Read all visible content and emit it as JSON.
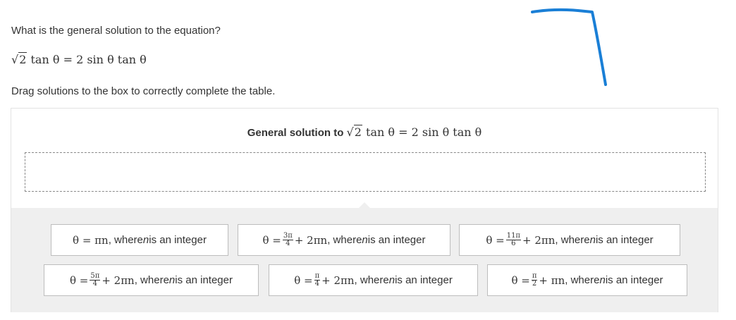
{
  "question": "What is the general solution to the equation?",
  "equation": {
    "lhs_coef_radicand": "2",
    "lhs_func": "tan θ",
    "equals": "=",
    "rhs": "2 sin θ tan θ"
  },
  "instruction": "Drag solutions to the box to correctly complete the table.",
  "table": {
    "title_text": "General solution to",
    "title_radicand": "2",
    "title_rest": "tan θ = 2 sin θ tan θ"
  },
  "tiles": [
    {
      "lead": "θ = πn",
      "num": "",
      "den": "",
      "tail": "",
      "suffix_pre": ", where ",
      "var": "n",
      "suffix_post": " is an integer"
    },
    {
      "lead": "θ = ",
      "num": "3π",
      "den": "4",
      "tail": "+ 2πn",
      "suffix_pre": ", where ",
      "var": "n",
      "suffix_post": " is an integer"
    },
    {
      "lead": "θ = ",
      "num": "11π",
      "den": "6",
      "tail": "+ 2πn",
      "suffix_pre": ", where ",
      "var": "n",
      "suffix_post": " is an integer"
    },
    {
      "lead": "θ = ",
      "num": "5π",
      "den": "4",
      "tail": "+ 2πn",
      "suffix_pre": ", where ",
      "var": "n",
      "suffix_post": " is an integer"
    },
    {
      "lead": "θ = ",
      "num": "π",
      "den": "4",
      "tail": "+ 2πn",
      "suffix_pre": ", where ",
      "var": "n",
      "suffix_post": " is an integer"
    },
    {
      "lead": "θ = ",
      "num": "π",
      "den": "2",
      "tail": "+ πn",
      "suffix_pre": ", where ",
      "var": "n",
      "suffix_post": " is an integer"
    }
  ],
  "colors": {
    "pen_stroke": "#1a7fd6",
    "tray_bg": "#efefef",
    "tile_border": "#bdbdbd"
  }
}
